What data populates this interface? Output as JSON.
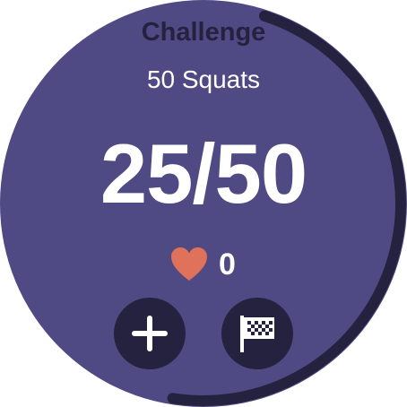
{
  "screen": {
    "title": "Challenge",
    "challenge_name": "50 Squats",
    "counter": "25/50",
    "progress": 0.5
  },
  "heart_rate": {
    "icon": "heart-icon",
    "value": "0"
  },
  "actions": {
    "add_icon": "plus-icon",
    "finish_icon": "checkered-flag-icon"
  },
  "colors": {
    "background": "#4f4a84",
    "dark_accent": "#25223f",
    "heart": "#e0715a",
    "text": "#ffffff"
  }
}
